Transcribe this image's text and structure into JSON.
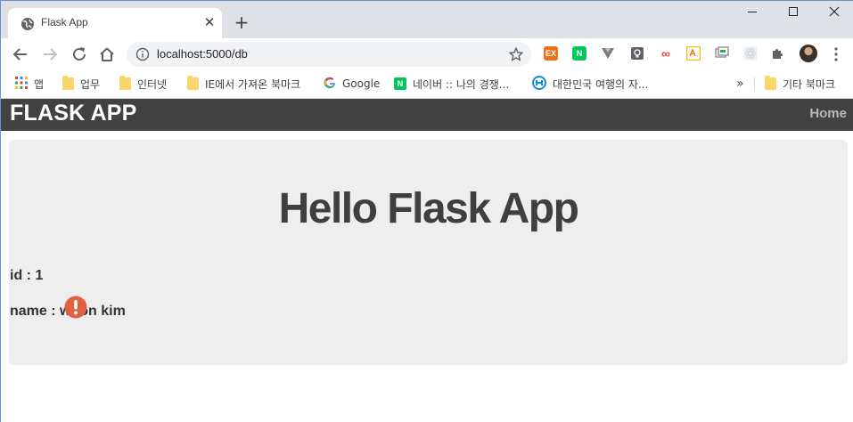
{
  "browser": {
    "tab": {
      "title": "Flask App",
      "close": "✕"
    },
    "new_tab": "+",
    "address": {
      "url": "localhost:5000/db"
    },
    "extensions": [
      {
        "name": "ex-extension-icon",
        "label": "EX",
        "color": "#e8711a"
      },
      {
        "name": "naver-extension-icon",
        "label": "N",
        "color": "#03c75a"
      },
      {
        "name": "vuejs-extension-icon",
        "label": "",
        "color": "#7a7a7a"
      },
      {
        "name": "keep-extension-icon",
        "label": "",
        "color": "#5f6368"
      },
      {
        "name": "infinity-extension-icon",
        "label": "∞",
        "color": "#ea4335"
      },
      {
        "name": "translate-extension-icon",
        "label": "",
        "color": "#fbbc04"
      },
      {
        "name": "window-extension-icon",
        "label": "",
        "color": "#80868b"
      },
      {
        "name": "react-extension-icon",
        "label": "",
        "color": "#dadce0"
      },
      {
        "name": "puzzle-icon",
        "label": "",
        "color": "#5f6368"
      }
    ],
    "bookmarks": [
      {
        "label": "앱",
        "kind": "apps"
      },
      {
        "label": "업무",
        "kind": "folder"
      },
      {
        "label": "인터넷",
        "kind": "folder"
      },
      {
        "label": "IE에서 가져온 북마크",
        "kind": "folder"
      },
      {
        "label": "Google",
        "kind": "google"
      },
      {
        "label": "네이버 :: 나의 경쟁...",
        "kind": "naver"
      },
      {
        "label": "대한민국 여행의 자...",
        "kind": "travel"
      }
    ],
    "bookmarks_overflow": "»",
    "other_bookmarks": "기타 북마크"
  },
  "app": {
    "brand": "FLASK APP",
    "nav_home": "Home",
    "heading": "Hello Flask App",
    "id_line": "id : 1",
    "name_line": "name : woon kim"
  },
  "colors": {
    "navbar": "#424242",
    "jumbotron": "#eeeeee",
    "alert": "#e06040"
  }
}
